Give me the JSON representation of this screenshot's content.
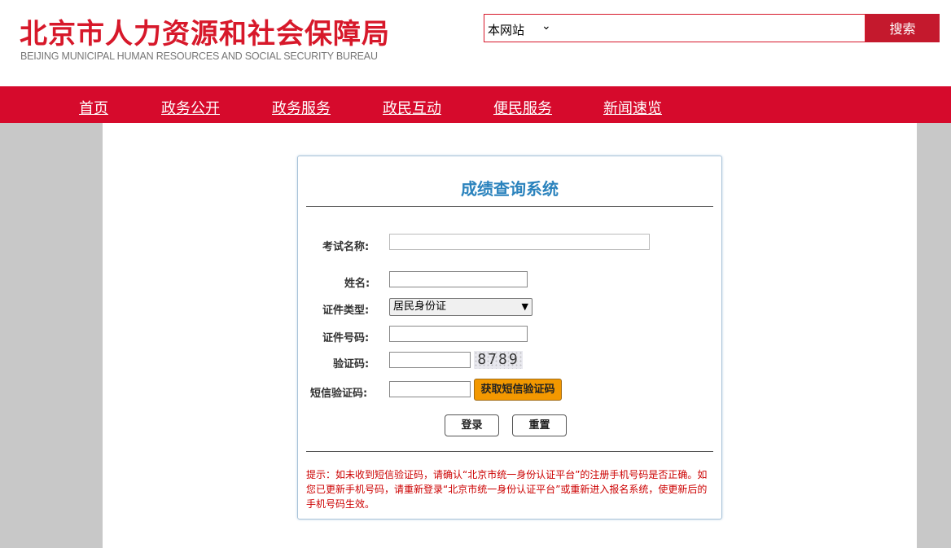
{
  "header": {
    "title": "北京市人力资源和社会保障局",
    "subtitle": "BEIJING MUNICIPAL HUMAN RESOURCES AND SOCIAL SECURITY BUREAU",
    "search_scope": "本网站",
    "search_button": "搜索",
    "search_value": ""
  },
  "nav": {
    "items": [
      {
        "label": "首页"
      },
      {
        "label": "政务公开"
      },
      {
        "label": "政务服务"
      },
      {
        "label": "政民互动"
      },
      {
        "label": "便民服务"
      },
      {
        "label": "新闻速览"
      }
    ]
  },
  "form": {
    "title": "成绩查询系统",
    "exam_name_label": "考试名称:",
    "exam_name_value": "",
    "name_label": "姓名:",
    "name_value": "",
    "id_type_label": "证件类型:",
    "id_type_value": "居民身份证",
    "id_number_label": "证件号码:",
    "id_number_value": "",
    "captcha_label": "验证码:",
    "captcha_value": "",
    "captcha_image_text": "8789",
    "sms_label": "短信验证码:",
    "sms_value": "",
    "sms_button": "获取短信验证码",
    "login_button": "登录",
    "reset_button": "重置",
    "tip": "提示：如未收到短信验证码，请确认“北京市统一身份认证平台”的注册手机号码是否正确。如您已更新手机号码，请重新登录“北京市统一身份认证平台”或重新进入报名系统，使更新后的手机号码生效。"
  },
  "colors": {
    "brand_red": "#d60a2c",
    "title_blue": "#2b83bd",
    "sms_orange": "#f39800",
    "tip_red": "#cc0000",
    "side_gray": "#c8c8c8"
  }
}
